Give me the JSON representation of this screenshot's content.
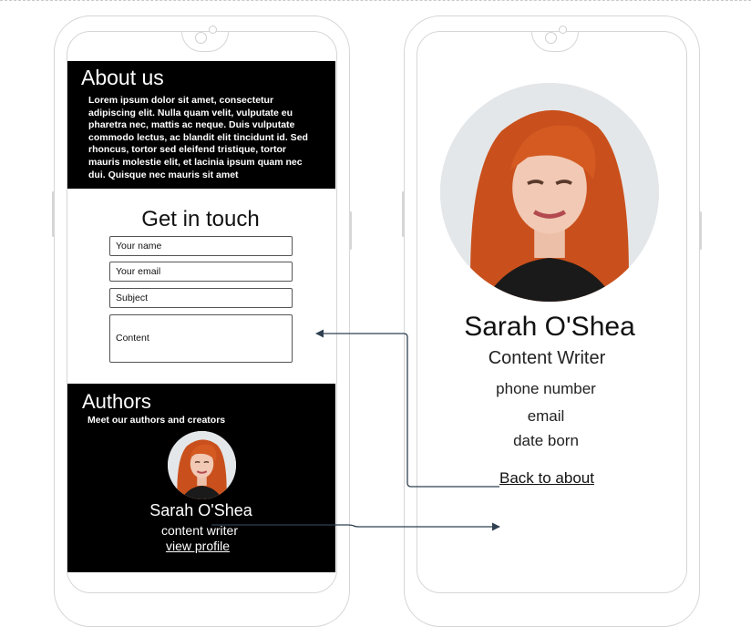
{
  "left_phone": {
    "about": {
      "title": "About us",
      "body": "Lorem ipsum dolor sit amet, consectetur adipiscing elit. Nulla quam velit, vulputate eu pharetra nec, mattis ac neque. Duis vulputate commodo lectus, ac blandit elit tincidunt id. Sed rhoncus, tortor sed eleifend tristique, tortor mauris molestie elit, et lacinia ipsum quam nec dui. Quisque nec mauris sit amet"
    },
    "contact": {
      "title": "Get in touch",
      "name_placeholder": "Your name",
      "email_placeholder": "Your email",
      "subject_placeholder": "Subject",
      "content_placeholder": "Content"
    },
    "authors": {
      "title": "Authors",
      "subtitle": "Meet our authors and creators",
      "author_name": "Sarah O'Shea",
      "author_role": "content writer",
      "view_profile": "view profile"
    }
  },
  "right_phone": {
    "profile": {
      "name": "Sarah O'Shea",
      "role": "Content Writer",
      "phone": "phone number",
      "email": "email",
      "date_born": "date born",
      "back_link": "Back to about"
    }
  },
  "colors": {
    "section_background": "#000000",
    "device_outline": "#d6d6d6",
    "arrow": "#2f4050",
    "hair": "#d2561f"
  }
}
